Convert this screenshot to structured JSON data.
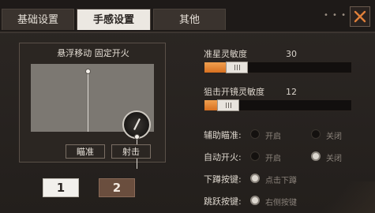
{
  "tabs": [
    {
      "label": "基础设置",
      "active": false
    },
    {
      "label": "手感设置",
      "active": true
    },
    {
      "label": "其他",
      "active": false
    }
  ],
  "window": {
    "menu_dots": "• • •",
    "close_icon": "close-icon"
  },
  "preview": {
    "title": "悬浮移动 固定开火",
    "aim_label": "瞄准",
    "fire_label": "射击"
  },
  "presets": [
    "1",
    "2"
  ],
  "sensitivity": [
    {
      "label": "准星灵敏度",
      "value": "30",
      "fraction": 0.22
    },
    {
      "label": "狙击开镜灵敏度",
      "value": "12",
      "fraction": 0.16
    }
  ],
  "options": [
    {
      "label": "辅助瞄准:",
      "opt_a": "开启",
      "opt_b": "关闭",
      "selected": "b"
    },
    {
      "label": "自动开火:",
      "opt_a": "开启",
      "opt_b": "关闭",
      "selected": "b"
    },
    {
      "label": "下蹲按键:",
      "opt_a": "点击下蹲",
      "opt_b": "",
      "selected": "a"
    },
    {
      "label": "跳跃按键:",
      "opt_a": "右侧按键",
      "opt_b": "",
      "selected": "a"
    }
  ],
  "colors": {
    "accent_orange": "#e88a3a",
    "active_tab": "#ece8e2",
    "preset_inactive": "#6a4e3e"
  }
}
